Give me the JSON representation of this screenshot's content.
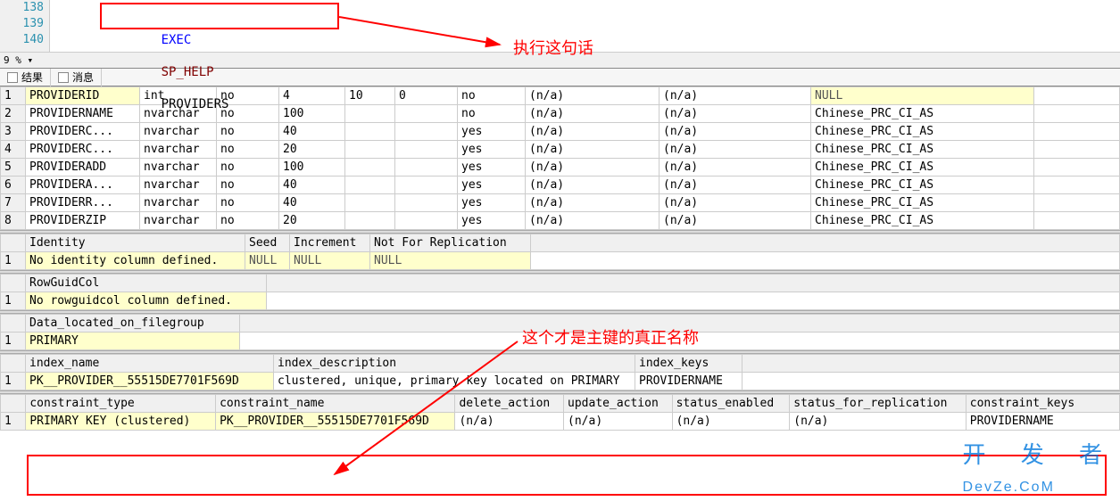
{
  "editor": {
    "line_numbers": [
      "138",
      "139",
      "140"
    ],
    "code_exec": "EXEC",
    "code_sp": "SP_HELP",
    "code_arg": "PROVIDERS"
  },
  "zoom": {
    "label": "9 %",
    "dropdown_icon": "▾"
  },
  "tabs": {
    "results": "结果",
    "messages": "消息"
  },
  "columns_table": {
    "rows": [
      {
        "n": "1",
        "name": "PROVIDERID",
        "type": "int",
        "c3": "no",
        "len": "4",
        "prec": "10",
        "scale": "0",
        "nullable": "no",
        "c8": "(n/a)",
        "c9": "(n/a)",
        "c10": "NULL",
        "hl_name": true,
        "hl_c10": true
      },
      {
        "n": "2",
        "name": "PROVIDERNAME",
        "type": "nvarchar",
        "c3": "no",
        "len": "100",
        "prec": "",
        "scale": "",
        "nullable": "no",
        "c8": "(n/a)",
        "c9": "(n/a)",
        "c10": "Chinese_PRC_CI_AS"
      },
      {
        "n": "3",
        "name": "PROVIDERC...",
        "type": "nvarchar",
        "c3": "no",
        "len": "40",
        "prec": "",
        "scale": "",
        "nullable": "yes",
        "c8": "(n/a)",
        "c9": "(n/a)",
        "c10": "Chinese_PRC_CI_AS"
      },
      {
        "n": "4",
        "name": "PROVIDERC...",
        "type": "nvarchar",
        "c3": "no",
        "len": "20",
        "prec": "",
        "scale": "",
        "nullable": "yes",
        "c8": "(n/a)",
        "c9": "(n/a)",
        "c10": "Chinese_PRC_CI_AS"
      },
      {
        "n": "5",
        "name": "PROVIDERADD",
        "type": "nvarchar",
        "c3": "no",
        "len": "100",
        "prec": "",
        "scale": "",
        "nullable": "yes",
        "c8": "(n/a)",
        "c9": "(n/a)",
        "c10": "Chinese_PRC_CI_AS"
      },
      {
        "n": "6",
        "name": "PROVIDERA...",
        "type": "nvarchar",
        "c3": "no",
        "len": "40",
        "prec": "",
        "scale": "",
        "nullable": "yes",
        "c8": "(n/a)",
        "c9": "(n/a)",
        "c10": "Chinese_PRC_CI_AS"
      },
      {
        "n": "7",
        "name": "PROVIDERR...",
        "type": "nvarchar",
        "c3": "no",
        "len": "40",
        "prec": "",
        "scale": "",
        "nullable": "yes",
        "c8": "(n/a)",
        "c9": "(n/a)",
        "c10": "Chinese_PRC_CI_AS"
      },
      {
        "n": "8",
        "name": "PROVIDERZIP",
        "type": "nvarchar",
        "c3": "no",
        "len": "20",
        "prec": "",
        "scale": "",
        "nullable": "yes",
        "c8": "(n/a)",
        "c9": "(n/a)",
        "c10": "Chinese_PRC_CI_AS"
      }
    ]
  },
  "identity_table": {
    "headers": [
      "Identity",
      "Seed",
      "Increment",
      "Not For Replication"
    ],
    "row": {
      "n": "1",
      "c1": "No identity column defined.",
      "c2": "NULL",
      "c3": "NULL",
      "c4": "NULL"
    }
  },
  "rowguid_table": {
    "header": "RowGuidCol",
    "row": {
      "n": "1",
      "c1": "No rowguidcol column defined."
    }
  },
  "filegroup_table": {
    "header": "Data_located_on_filegroup",
    "row": {
      "n": "1",
      "c1": "PRIMARY"
    }
  },
  "index_table": {
    "headers": [
      "index_name",
      "index_description",
      "index_keys"
    ],
    "row": {
      "n": "1",
      "c1": "PK__PROVIDER__55515DE7701F569D",
      "c2": "clustered, unique, primary key located on PRIMARY",
      "c3": "PROVIDERNAME"
    }
  },
  "constraint_table": {
    "headers": [
      "constraint_type",
      "constraint_name",
      "delete_action",
      "update_action",
      "status_enabled",
      "status_for_replication",
      "constraint_keys"
    ],
    "row": {
      "n": "1",
      "c1": "PRIMARY KEY (clustered)",
      "c2": "PK__PROVIDER__55515DE7701F569D",
      "c3": "(n/a)",
      "c4": "(n/a)",
      "c5": "(n/a)",
      "c6": "(n/a)",
      "c7": "PROVIDERNAME"
    }
  },
  "annotations": {
    "a1": "执行这句话",
    "a2": "这个才是主键的真正名称"
  },
  "watermark": "开 发 者\nDevZe.CoM"
}
